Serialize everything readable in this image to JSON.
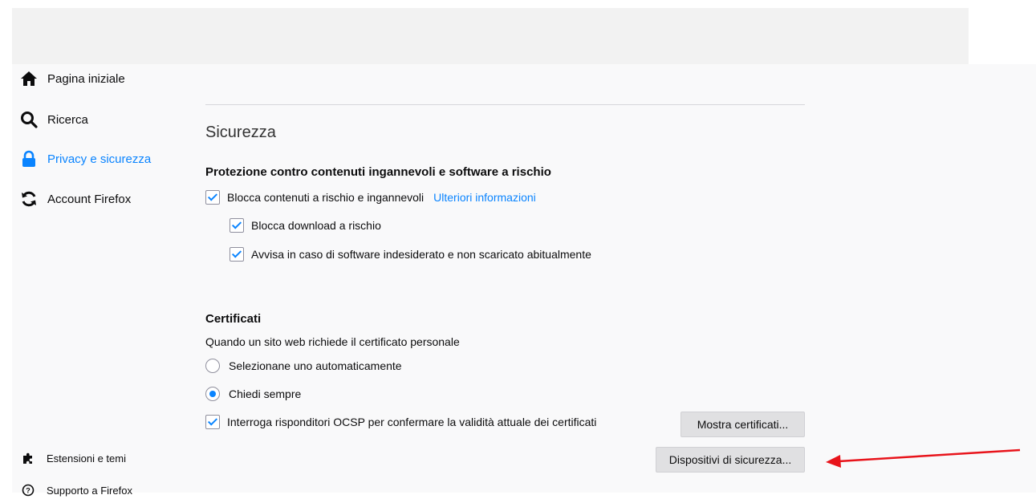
{
  "sidebar": {
    "items": [
      {
        "label": "Pagina iniziale",
        "icon": "home-icon"
      },
      {
        "label": "Ricerca",
        "icon": "search-icon"
      },
      {
        "label": "Privacy e sicurezza",
        "icon": "lock-icon"
      },
      {
        "label": "Account Firefox",
        "icon": "sync-icon"
      }
    ],
    "footer": [
      {
        "label": "Estensioni e temi",
        "icon": "puzzle-icon"
      },
      {
        "label": "Supporto a Firefox",
        "icon": "help-icon"
      }
    ]
  },
  "colors": {
    "accent": "#0a84ff",
    "annotation_arrow": "#e8141b"
  },
  "security": {
    "title": "Sicurezza",
    "deceptive_group": "Protezione contro contenuti ingannevoli e software a rischio",
    "block_dangerous": "Blocca contenuti a rischio e ingannevoli",
    "learn_more": "Ulteriori informazioni",
    "block_downloads": "Blocca download a rischio",
    "warn_unwanted": "Avvisa in caso di software indesiderato e non scaricato abitualmente"
  },
  "certificates": {
    "title": "Certificati",
    "question": "Quando un sito web richiede il certificato personale",
    "auto_select": "Selezionane uno automaticamente",
    "ask_always": "Chiedi sempre",
    "ocsp": "Interroga risponditori OCSP per confermare la validità attuale dei certificati",
    "view_certificates": "Mostra certificati...",
    "security_devices": "Dispositivi di sicurezza..."
  }
}
